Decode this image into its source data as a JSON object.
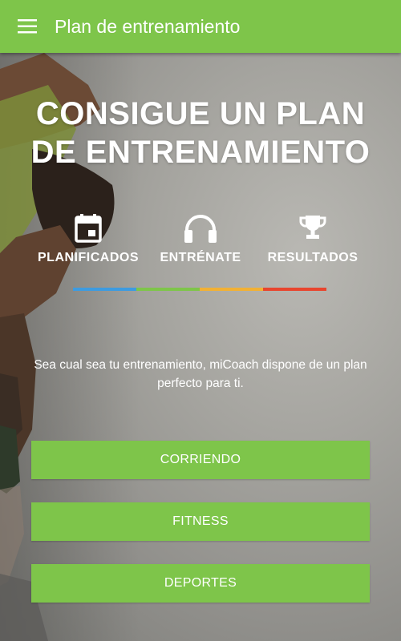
{
  "app_bar": {
    "title": "Plan de entrenamiento",
    "menu_icon": "hamburger-menu-icon",
    "color": "#7ec54a"
  },
  "hero": {
    "headline_line1": "CONSIGUE UN PLAN",
    "headline_line2": "DE ENTRENAMIENTO"
  },
  "features": [
    {
      "icon": "calendar-icon",
      "label": "PLANIFICADOS"
    },
    {
      "icon": "headphones-icon",
      "label": "ENTRÉNATE"
    },
    {
      "icon": "trophy-icon",
      "label": "RESULTADOS"
    }
  ],
  "color_bar": [
    "#3d9be0",
    "#7ec54a",
    "#f2b134",
    "#e8452e"
  ],
  "description": "Sea cual sea tu entrenamiento, miCoach dispone de un plan perfecto para ti.",
  "buttons": {
    "running": "CORRIENDO",
    "fitness": "FITNESS",
    "sports": "DEPORTES"
  }
}
